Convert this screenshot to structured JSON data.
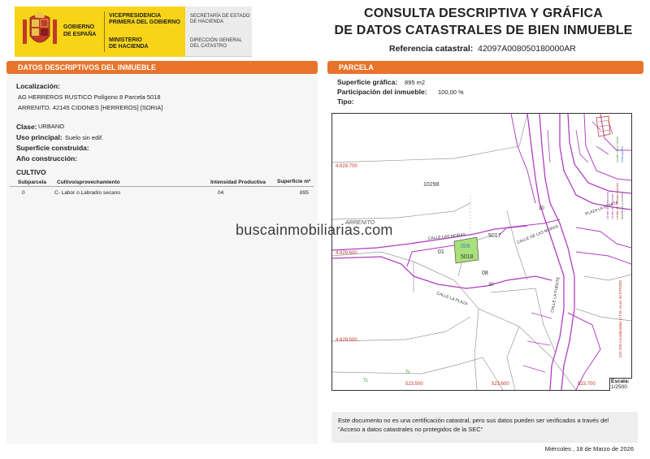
{
  "header": {
    "logo_left_lines": [
      "GOBIERNO",
      "DE ESPAÑA"
    ],
    "logo_mid_top": [
      "VICEPRESIDENCIA",
      "PRIMERA DEL GOBIERNO"
    ],
    "logo_mid_bottom": [
      "MINISTERIO",
      "DE HACIENDA"
    ],
    "logo_right_top": [
      "SECRETARÍA DE ESTADO",
      "DE HACIENDA"
    ],
    "logo_right_bottom": [
      "DIRECCIÓN GENERAL",
      "DEL CATASTRO"
    ],
    "title_line1": "CONSULTA DESCRIPTIVA Y GRÁFICA",
    "title_line2": "DE DATOS CATASTRALES DE BIEN INMUEBLE",
    "ref_label": "Referencia catastral:",
    "ref_value": "42097A008050180000AR"
  },
  "left": {
    "section_title": "DATOS DESCRIPTIVOS DEL INMUEBLE",
    "localizacion_label": "Localización:",
    "localizacion_line1": "AG HERREROS RUSTICO  Polígono 8 Parcela 5018",
    "localizacion_line2": "ARRENITO. 42145 CIDONES [HERREROS] [SORIA]",
    "clase_label": "Clase:",
    "clase_value": "URBANO",
    "uso_label": "Uso principal:",
    "uso_value": "Suelo sin edif.",
    "superficie_label": "Superficie construida:",
    "anio_label": "Año construcción:",
    "cultivo": {
      "title": "CULTIVO",
      "headers": [
        "Subparcela",
        "Cultivo/aprovechamiento",
        "Intensidad Productiva",
        "Superficie m²"
      ],
      "rows": [
        [
          "0",
          "C- Labor o Labradío secano",
          "04",
          "895"
        ]
      ]
    }
  },
  "right": {
    "section_title": "PARCELA",
    "sup_grafica_label": "Superficie gráfica:",
    "sup_grafica_value": "895 m2",
    "participacion_label": "Participación del inmueble:",
    "participacion_value": "100,00 %",
    "tipo_label": "Tipo:",
    "map": {
      "coord_labels": [
        "4.629.700",
        "4.629.600",
        "4.629.500",
        "523.500",
        "523.600",
        "523.700"
      ],
      "parcel_labels": [
        "10298",
        "5017",
        "01",
        "008",
        "5018",
        "08",
        "20",
        "10"
      ],
      "street_labels": [
        "CALLE LAS MORAS",
        "CALLE DE LAS MORAS",
        "ARRENITO",
        "PLAZA LA ERMITA",
        "CALLE LA PLAZA",
        "CALLE LA FUENTE"
      ],
      "vertical_legend": "523.700 Coordenadas U.T.M. Huso 30 ETRS89",
      "legend_items": [
        "Límite de Manzana",
        "Límite de Parcela",
        "Límite de Construcciones",
        "Mobiliario y aceras",
        "Límite zona verde",
        "Hidrografía"
      ],
      "small_labels": [
        "Tc",
        "Tc"
      ]
    },
    "scale_label": "Escala:",
    "scale_value": "1/2500",
    "notice": "Este documento no es una certificación catastral, pero sus datos pueden ser verificados a través del \"Acceso a datos catastrales no protegidos de la SEC\"",
    "date": "Miércoles , 18 de Marzo de 2026"
  },
  "watermark": "buscainmobiliarias.com",
  "colors": {
    "orange": "#e8742c",
    "logo_yellow": "#f7d417",
    "parcel_purple": "#b040c0",
    "selected_green": "#a8e07a",
    "coord_red": "#c0392b"
  }
}
